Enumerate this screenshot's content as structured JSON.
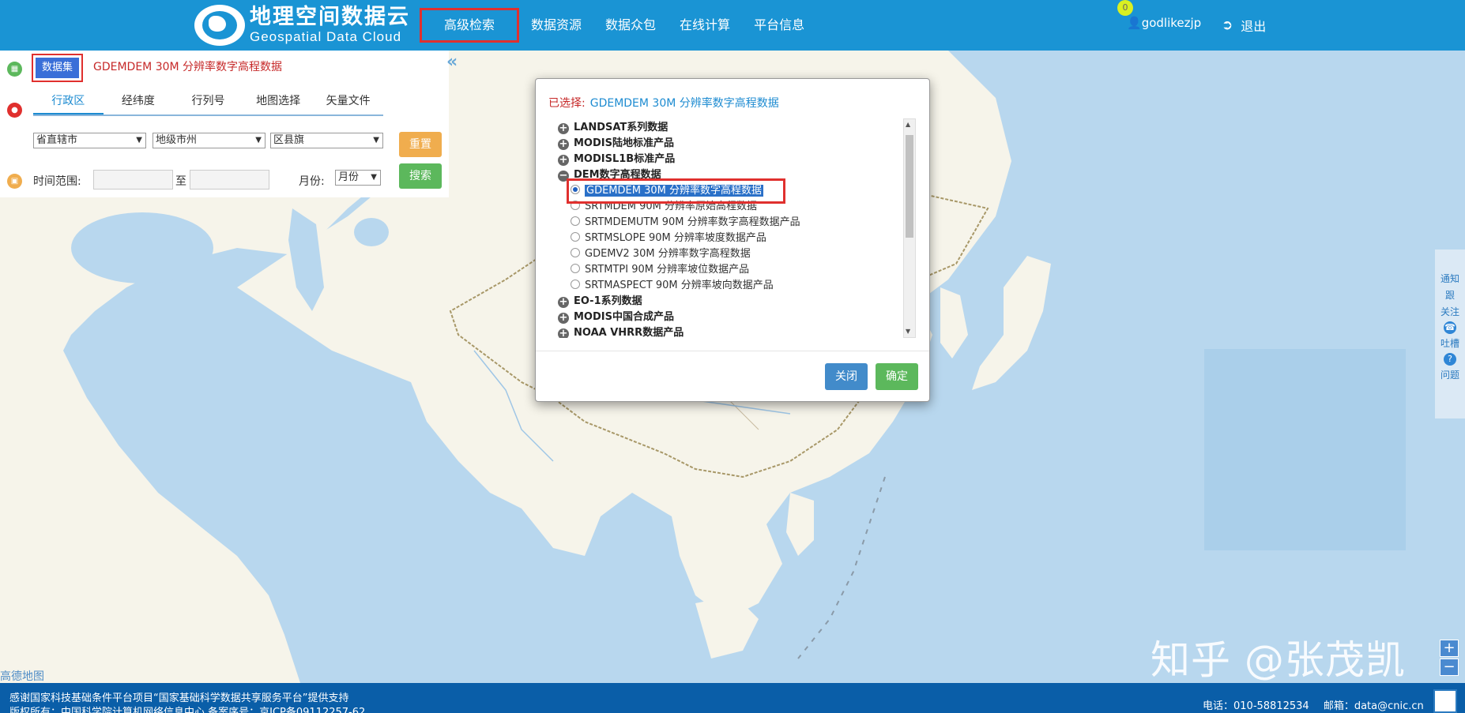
{
  "header": {
    "logo_cn": "地理空间数据云",
    "logo_en": "Geospatial Data Cloud",
    "nav": [
      "高级检索",
      "数据资源",
      "数据众包",
      "在线计算",
      "平台信息"
    ],
    "notification_count": "0",
    "username": "godlikezjp",
    "logout": "退出"
  },
  "search_panel": {
    "dataset_button": "数据集",
    "dataset_name": "GDEMDEM 30M 分辨率数字高程数据",
    "tabs": [
      "行政区",
      "经纬度",
      "行列号",
      "地图选择",
      "矢量文件"
    ],
    "province_select": "省直辖市",
    "city_select": "地级市州",
    "county_select": "区县旗",
    "reset_button": "重置",
    "search_button": "搜索",
    "time_label": "时间范围:",
    "to_label": "至",
    "month_label": "月份:",
    "month_select": "月份"
  },
  "dialog": {
    "selected_label": "已选择:",
    "selected_value": "GDEMDEM 30M 分辨率数字高程数据",
    "groups": [
      "LANDSAT系列数据",
      "MODIS陆地标准产品",
      "MODISL1B标准产品",
      "DEM数字高程数据"
    ],
    "dem_items": [
      "GDEMDEM 30M 分辨率数字高程数据",
      "SRTMDEM 90M 分辨率原始高程数据",
      "SRTMDEMUTM 90M 分辨率数字高程数据产品",
      "SRTMSLOPE 90M 分辨率坡度数据产品",
      "GDEMV2 30M 分辨率数字高程数据",
      "SRTMTPI 90M 分辨率坡位数据产品",
      "SRTMASPECT 90M 分辨率坡向数据产品"
    ],
    "more_groups": [
      "EO-1系列数据",
      "MODIS中国合成产品",
      "NOAA VHRR数据产品"
    ],
    "close_button": "关闭",
    "ok_button": "确定"
  },
  "right_tools": [
    "通知",
    "跟",
    "关注",
    "吐槽",
    "问题"
  ],
  "map": {
    "credit": "高德地图",
    "watermark": "知乎 @张茂凯"
  },
  "footer": {
    "line1": "感谢国家科技基础条件平台项目“国家基础科学数据共享服务平台”提供支持",
    "line2": "版权所有：中国科学院计算机网络信息中心 备案序号：京ICP备09112257-62",
    "phone_label": "电话：",
    "phone": "010-58812534",
    "email_label": "邮箱：",
    "email": "data@cnic.cn"
  },
  "colors": {
    "header_bg": "#1a94d4",
    "footer_bg": "#0a5ea8",
    "highlight_red": "#e0302e",
    "reset_orange": "#f0ad4e",
    "search_green": "#5cb85c",
    "close_blue": "#428bca"
  },
  "icons": [
    "user-icon",
    "logout-icon",
    "dataset-icon",
    "location-icon",
    "calendar-icon",
    "plus-icon",
    "minus-icon",
    "phone-icon",
    "question-icon"
  ]
}
